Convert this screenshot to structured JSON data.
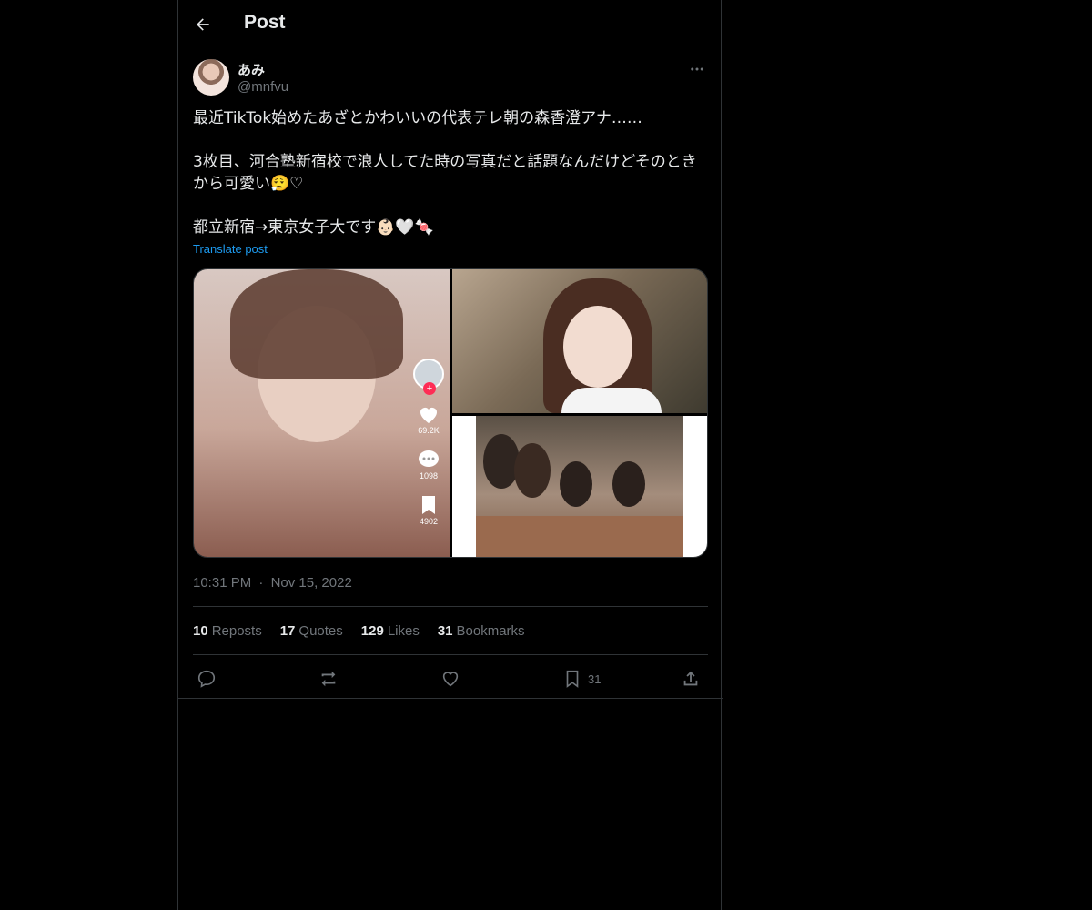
{
  "header": {
    "title": "Post"
  },
  "author": {
    "name": "あみ",
    "handle": "@mnfvu"
  },
  "tweet": {
    "line1": "最近TikTok始めたあざとかわいいの代表テレ朝の森香澄アナ……",
    "line2": "3枚目、河合塾新宿校で浪人してた時の写真だと話題なんだけどそのとき",
    "line3": "から可愛い😮‍💨♡",
    "line4": "都立新宿→東京女子大です👶🏻🤍🍬",
    "translate": "Translate post"
  },
  "media": {
    "tiktok": {
      "likes": "69.2K",
      "comments": "1098",
      "saves": "4902"
    }
  },
  "meta": {
    "time": "10:31 PM",
    "separator": "·",
    "date": "Nov 15, 2022"
  },
  "stats": [
    {
      "count": "10",
      "label": "Reposts"
    },
    {
      "count": "17",
      "label": "Quotes"
    },
    {
      "count": "129",
      "label": "Likes"
    },
    {
      "count": "31",
      "label": "Bookmarks"
    }
  ],
  "actions": {
    "bookmark_count": "31"
  },
  "colors": {
    "accent": "#1d9bf0",
    "background": "#000000",
    "border": "#2f3336",
    "muted": "#71767b"
  }
}
